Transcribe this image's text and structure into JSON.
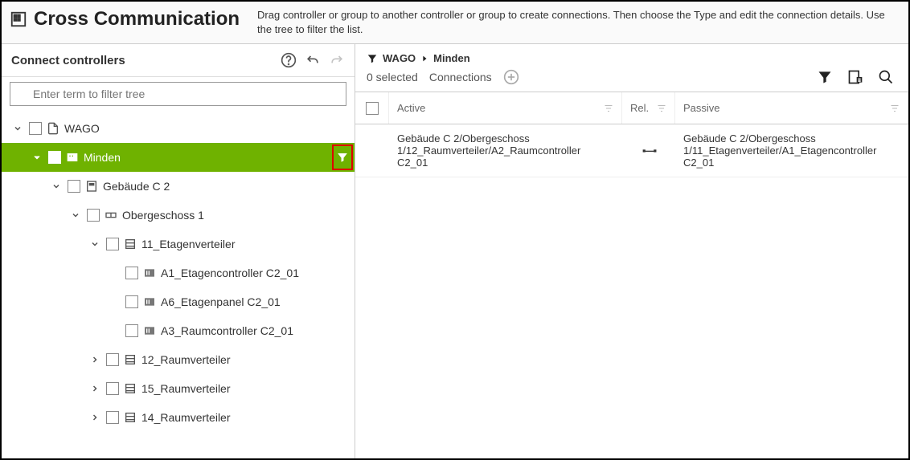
{
  "header": {
    "title": "Cross Communication",
    "description": "Drag controller or group to another controller or group to create connections. Then choose the Type and edit the connection details. Use the tree to filter the list."
  },
  "left": {
    "title": "Connect controllers",
    "search_placeholder": "Enter term to filter tree"
  },
  "tree": {
    "root": {
      "label": "WAGO",
      "checked": false
    },
    "minden": {
      "label": "Minden",
      "checked": true
    },
    "gebaeude": {
      "label": "Gebäude C 2"
    },
    "og1": {
      "label": "Obergeschoss 1"
    },
    "ev11": {
      "label": "11_Etagenverteiler"
    },
    "a1": {
      "label": "A1_Etagencontroller C2_01"
    },
    "a6": {
      "label": "A6_Etagenpanel C2_01"
    },
    "a3": {
      "label": "A3_Raumcontroller C2_01"
    },
    "rv12": {
      "label": "12_Raumverteiler"
    },
    "rv15": {
      "label": "15_Raumverteiler"
    },
    "rv14": {
      "label": "14_Raumverteiler"
    }
  },
  "right": {
    "breadcrumb": {
      "root": "WAGO",
      "current": "Minden"
    },
    "selected_text": "0 selected",
    "connections_label": "Connections",
    "columns": {
      "active": "Active",
      "rel": "Rel.",
      "passive": "Passive"
    },
    "rows": [
      {
        "active": "Gebäude C 2/Obergeschoss 1/12_Raumverteiler/A2_Raumcontroller C2_01",
        "passive": "Gebäude C 2/Obergeschoss 1/11_Etagenverteiler/A1_Etagencontroller C2_01"
      }
    ]
  }
}
